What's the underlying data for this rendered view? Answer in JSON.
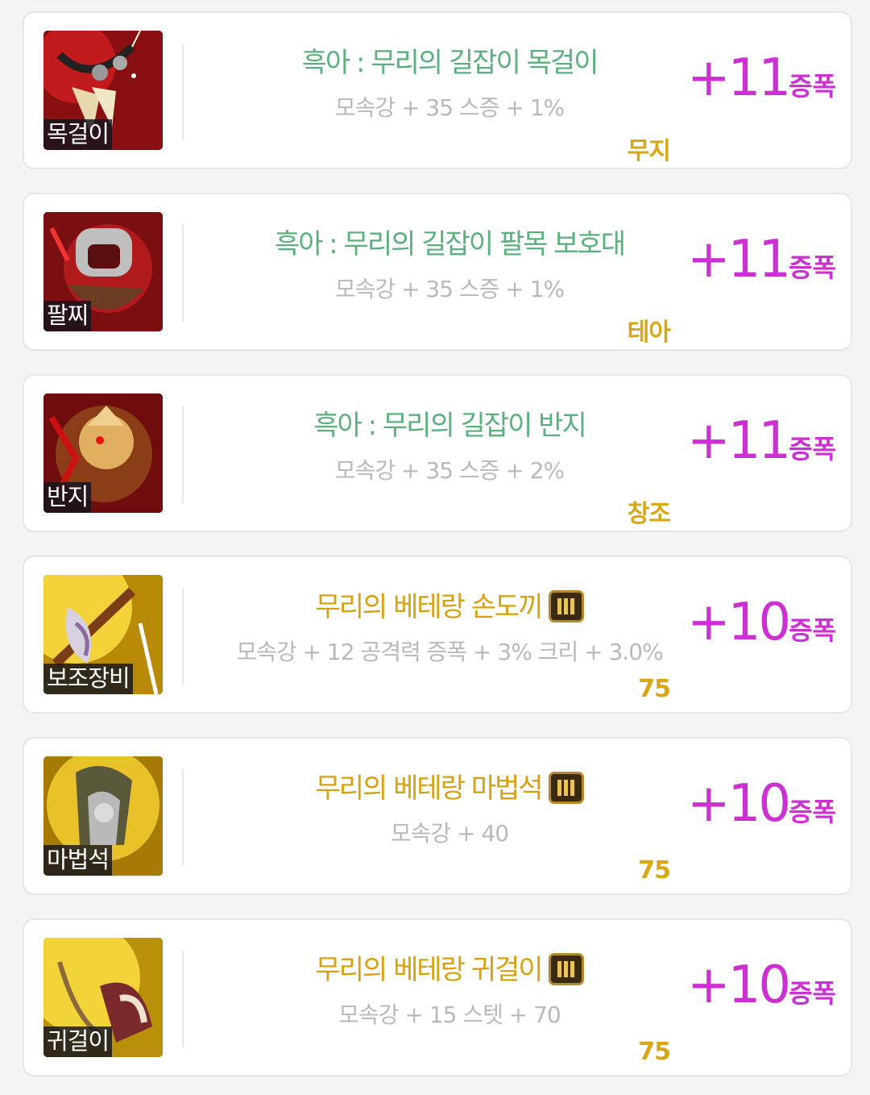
{
  "items": [
    {
      "slot_label": "목걸이",
      "name": "흑아 : 무리의 길잡이 목걸이",
      "grade": "epic",
      "stats": "모속강 + 35 스증 + 1%",
      "sub": "무지",
      "amp_value": "+11",
      "amp_unit": "증폭",
      "has_badge": false,
      "icon": "necklace-icon"
    },
    {
      "slot_label": "팔찌",
      "name": "흑아 : 무리의 길잡이 팔목 보호대",
      "grade": "epic",
      "stats": "모속강 + 35 스증 + 1%",
      "sub": "테아",
      "amp_value": "+11",
      "amp_unit": "증폭",
      "has_badge": false,
      "icon": "bracelet-icon"
    },
    {
      "slot_label": "반지",
      "name": "흑아 : 무리의 길잡이 반지",
      "grade": "epic",
      "stats": "모속강 + 35 스증 + 2%",
      "sub": "창조",
      "amp_value": "+11",
      "amp_unit": "증폭",
      "has_badge": false,
      "icon": "ring-icon"
    },
    {
      "slot_label": "보조장비",
      "name": "무리의 베테랑 손도끼",
      "grade": "gold",
      "stats": "모속강 + 12 공격력 증폭 + 3% 크리 + 3.0%",
      "sub": "75",
      "amp_value": "+10",
      "amp_unit": "증폭",
      "has_badge": true,
      "icon": "hand-axe-icon"
    },
    {
      "slot_label": "마법석",
      "name": "무리의 베테랑 마법석",
      "grade": "gold",
      "stats": "모속강 + 40",
      "sub": "75",
      "amp_value": "+10",
      "amp_unit": "증폭",
      "has_badge": true,
      "icon": "magic-stone-icon"
    },
    {
      "slot_label": "귀걸이",
      "name": "무리의 베테랑 귀걸이",
      "grade": "gold",
      "stats": "모속강 + 15 스텟 + 70",
      "sub": "75",
      "amp_value": "+10",
      "amp_unit": "증폭",
      "has_badge": true,
      "icon": "earring-icon"
    }
  ],
  "colors": {
    "epic_name": "#5ab17e",
    "gold_name": "#d7a110",
    "amplify": "#cc2fd2",
    "stats": "#b9b9b9",
    "sub": "#d9a714"
  },
  "badge_icon": "grade-three-badge-icon"
}
